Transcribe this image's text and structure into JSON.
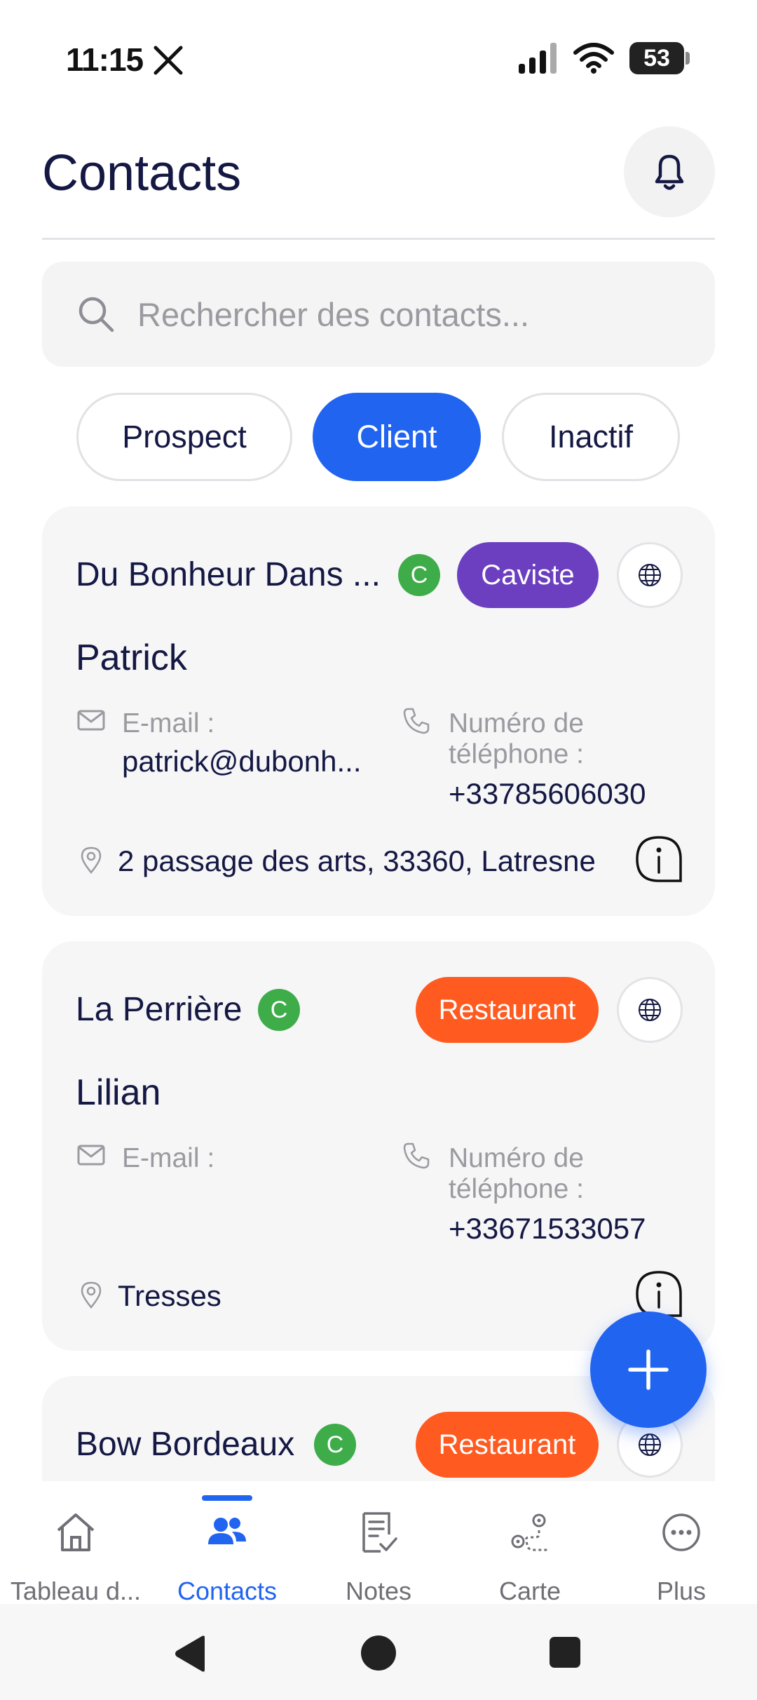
{
  "status_bar": {
    "time": "11:15",
    "battery": "53"
  },
  "header": {
    "title": "Contacts"
  },
  "search": {
    "placeholder": "Rechercher des contacts..."
  },
  "filters": [
    {
      "label": "Prospect",
      "active": false
    },
    {
      "label": "Client",
      "active": true
    },
    {
      "label": "Inactif",
      "active": false
    }
  ],
  "contacts": [
    {
      "company": "Du Bonheur Dans ...",
      "status_badge": "C",
      "category": "Caviste",
      "category_color": "#6b3fbf",
      "name": "Patrick",
      "email_label": "E-mail :",
      "email": "patrick@dubonh...",
      "phone_label": "Numéro de téléphone :",
      "phone": "+33785606030",
      "address": "2 passage des arts, 33360, Latresne"
    },
    {
      "company": "La Perrière",
      "status_badge": "C",
      "category": "Restaurant",
      "category_color": "#ff5a1f",
      "name": "Lilian",
      "email_label": "E-mail :",
      "email": "",
      "phone_label": "Numéro de téléphone :",
      "phone": "+33671533057",
      "address": "Tresses"
    },
    {
      "company": "Bow Bordeaux",
      "status_badge": "C",
      "category": "Restaurant",
      "category_color": "#ff5a1f"
    }
  ],
  "bottom_nav": [
    {
      "label": "Tableau d...",
      "icon": "home-icon",
      "active": false
    },
    {
      "label": "Contacts",
      "icon": "users-icon",
      "active": true
    },
    {
      "label": "Notes",
      "icon": "notes-icon",
      "active": false
    },
    {
      "label": "Carte",
      "icon": "map-route-icon",
      "active": false
    },
    {
      "label": "Plus",
      "icon": "more-icon",
      "active": false
    }
  ],
  "colors": {
    "accent": "#2164f0",
    "client_badge": "#3fac4a"
  }
}
